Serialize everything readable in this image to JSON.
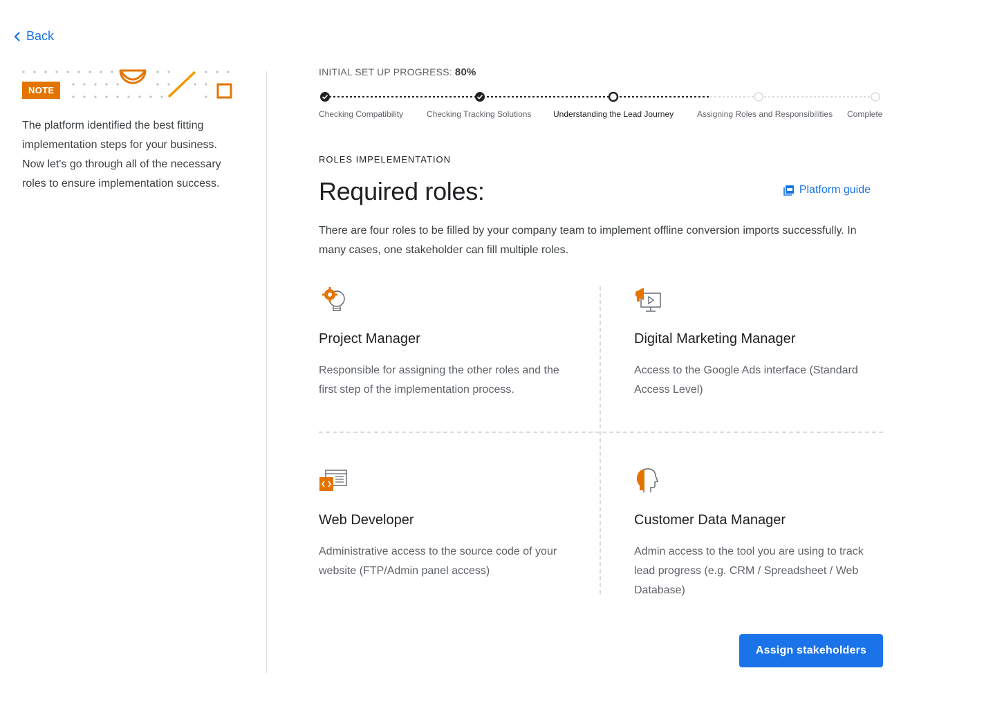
{
  "nav": {
    "back_label": "Back"
  },
  "note": {
    "badge": "NOTE",
    "text": "The platform identified the best fitting implementation steps for your business. Now let's go through all of the necessary roles to ensure implementation success."
  },
  "progress": {
    "label": "INITIAL SET UP PROGRESS:",
    "value": "80%",
    "steps": [
      {
        "label": "Checking Compatibility",
        "status": "done"
      },
      {
        "label": "Checking Tracking Solutions",
        "status": "done"
      },
      {
        "label": "Understanding the Lead Journey",
        "status": "current"
      },
      {
        "label": "Assigning Roles and Responsibilities",
        "status": "pending"
      },
      {
        "label": "Complete",
        "status": "pending"
      }
    ]
  },
  "section": {
    "eyebrow": "ROLES IMPELEMENTATION",
    "title": "Required roles:",
    "guide_label": "Platform guide",
    "intro": "There are four roles to be filled by your company team to implement offline conversion imports successfully. In many cases, one stakeholder can fill multiple roles."
  },
  "roles": [
    {
      "title": "Project Manager",
      "description": "Responsible for assigning the other roles and the first step of the implementation process.",
      "icon": "lightbulb-gear-icon"
    },
    {
      "title": "Digital Marketing Manager",
      "description": "Access to the Google Ads interface (Standard Access Level)",
      "icon": "megaphone-monitor-icon"
    },
    {
      "title": "Web Developer",
      "description": "Administrative access to the source code of your website (FTP/Admin panel access)",
      "icon": "code-window-icon"
    },
    {
      "title": "Customer Data Manager",
      "description": "Admin access to the tool you are using to track lead progress (e.g. CRM / Spreadsheet / Web Database)",
      "icon": "head-profile-icon"
    }
  ],
  "actions": {
    "assign_label": "Assign stakeholders"
  },
  "colors": {
    "accent": "#1a73e8",
    "orange": "#e37400",
    "text": "#3c4043"
  }
}
